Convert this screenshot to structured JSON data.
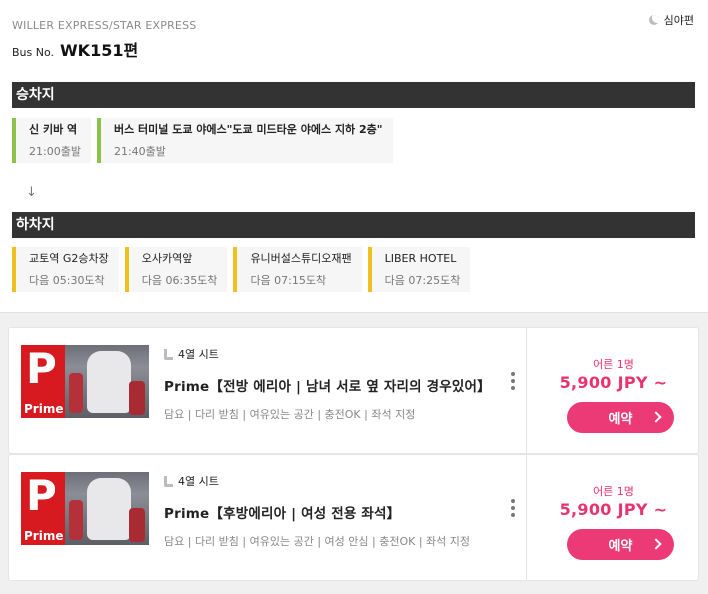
{
  "header": {
    "operator": "WILLER EXPRESS/STAR EXPRESS",
    "bus_no_label": "Bus No.",
    "bus_no": "WK151편",
    "night_label": "심야편"
  },
  "boarding": {
    "title": "승차지",
    "stops": [
      {
        "name": "신 키바 역",
        "time": "21:00출발"
      },
      {
        "name": "버스 터미널 도쿄 야에스\"도쿄 미드타운 야에스 지하 2층\"",
        "time": "21:40출발"
      }
    ]
  },
  "alighting": {
    "title": "하차지",
    "stops": [
      {
        "name": "교토역 G2승차장",
        "time": "다음 05:30도착"
      },
      {
        "name": "오사카역앞",
        "time": "다음 06:35도착"
      },
      {
        "name": "유니버설스튜디오재팬",
        "time": "다음 07:15도착"
      },
      {
        "name": "LIBER HOTEL",
        "time": "다음 07:25도착"
      }
    ]
  },
  "plans": [
    {
      "thumb_letter": "P",
      "thumb_label": "Prime",
      "seat_type": "4열 시트",
      "title": "Prime【전방 에리아 | 남녀 서로 옆 자리의 경우있어】",
      "features": "담요 | 다리 받침 | 여유있는 공간 | 충전OK | 좌석 지정",
      "adult_label": "어른 1명",
      "price": "5,900 JPY ~",
      "book_label": "예약"
    },
    {
      "thumb_letter": "P",
      "thumb_label": "Prime",
      "seat_type": "4열 시트",
      "title": "Prime【후방에리아 | 여성 전용 좌석】",
      "features": "담요 | 다리 받침 | 여유있는 공간 | 여성 안심 | 충전OK | 좌석 지정",
      "adult_label": "어른 1명",
      "price": "5,900 JPY ~",
      "book_label": "예약"
    }
  ],
  "icons": {
    "night": "moon-icon",
    "direction": "arrow-down-icon",
    "seat": "seat-icon",
    "more": "kebab-menu-icon",
    "book": "chevron-right-icon"
  },
  "colors": {
    "section_bar": "#333333",
    "boarding_accent": "#8bc34a",
    "alighting_accent": "#f0c020",
    "price": "#e8336c",
    "book_button": "#ec3a77",
    "prime_red": "#d71920"
  }
}
